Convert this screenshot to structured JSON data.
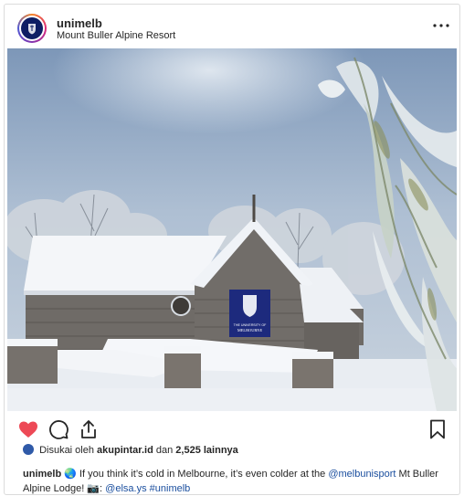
{
  "post": {
    "username": "unimelb",
    "location": "Mount Buller Alpine Resort",
    "more_icon": "more-horizontal-icon",
    "photo": {
      "sign_line1": "THE UNIVERSITY OF",
      "sign_line2": "MELBOURNE"
    },
    "actions": {
      "like_icon": "heart-filled-icon",
      "comment_icon": "comment-icon",
      "share_icon": "share-icon",
      "save_icon": "bookmark-icon",
      "like_color": "#ed4956"
    },
    "likes": {
      "prefix": "Disukai oleh",
      "liker": "akupintar.id",
      "connector": "dan",
      "count": "2,525",
      "suffix": "lainnya"
    },
    "caption": {
      "username": "unimelb",
      "emoji": "🌏",
      "text1": "If you think it’s cold in Melbourne, it’s even colder at the",
      "mention1": "@melbunisport",
      "text2": "Mt Buller Alpine Lodge!",
      "camera": "📷",
      "colon": ":",
      "mention2": "@elsa.ys",
      "hashtag": "#unimelb"
    }
  }
}
